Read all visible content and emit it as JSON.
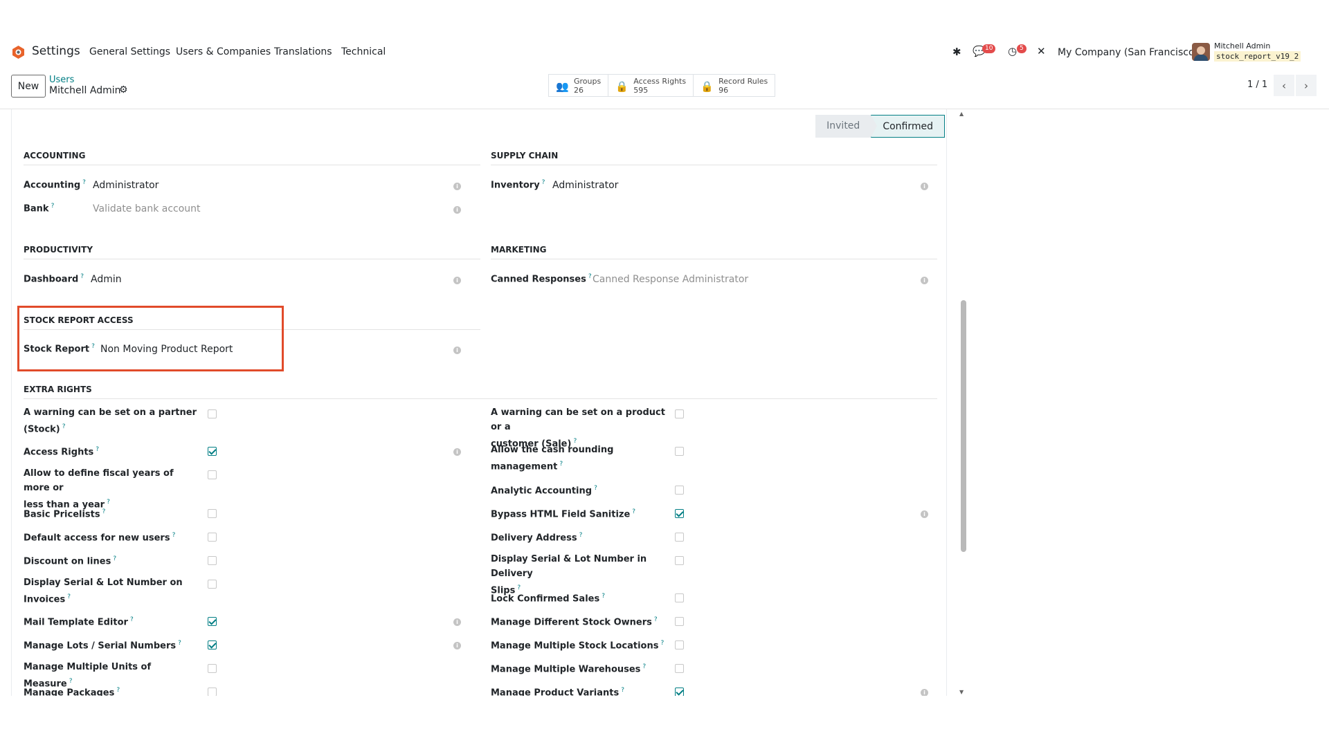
{
  "app": {
    "brand": "Settings",
    "menu": [
      "General Settings",
      "Users & Companies",
      "Translations",
      "Technical"
    ],
    "messages_badge": "10",
    "activities_badge": "5",
    "company": "My Company (San Francisco)",
    "user_name": "Mitchell Admin",
    "database": "stock_report_v19_2",
    "accent": "#017e84",
    "highlight": "#e14b2a"
  },
  "control": {
    "new_label": "New",
    "breadcrumb": "Users",
    "record": "Mitchell Admin",
    "smart": [
      {
        "label": "Groups",
        "count": "26"
      },
      {
        "label": "Access Rights",
        "count": "595"
      },
      {
        "label": "Record Rules",
        "count": "96"
      }
    ],
    "pager": "1 / 1"
  },
  "status": {
    "invited": "Invited",
    "confirmed": "Confirmed"
  },
  "sections": {
    "accounting": {
      "title": "ACCOUNTING",
      "fields": [
        {
          "label": "Accounting",
          "value": "Administrator"
        },
        {
          "label": "Bank",
          "value": "Validate bank account"
        }
      ]
    },
    "supply_chain": {
      "title": "SUPPLY CHAIN",
      "fields": [
        {
          "label": "Inventory",
          "value": "Administrator"
        }
      ]
    },
    "productivity": {
      "title": "PRODUCTIVITY",
      "fields": [
        {
          "label": "Dashboard",
          "value": "Admin"
        }
      ]
    },
    "marketing": {
      "title": "MARKETING",
      "fields": [
        {
          "label": "Canned Responses",
          "value": "Canned Response Administrator"
        }
      ]
    },
    "stock_report": {
      "title": "STOCK REPORT ACCESS",
      "fields": [
        {
          "label": "Stock Report",
          "value": "Non Moving Product Report"
        }
      ]
    },
    "extra_rights": {
      "title": "EXTRA RIGHTS",
      "left": [
        {
          "label1": "A warning can be set on a partner",
          "label2": "(Stock)",
          "checked": false
        },
        {
          "label1": "Access Rights",
          "label2": "",
          "checked": true
        },
        {
          "label1": "Allow to define fiscal years of more or",
          "label2": "less than a year",
          "checked": false
        },
        {
          "label1": "Basic Pricelists",
          "label2": "",
          "checked": false
        },
        {
          "label1": "Default access for new users",
          "label2": "",
          "checked": false
        },
        {
          "label1": "Discount on lines",
          "label2": "",
          "checked": false
        },
        {
          "label1": "Display Serial & Lot Number on",
          "label2": "Invoices",
          "checked": false
        },
        {
          "label1": "Mail Template Editor",
          "label2": "",
          "checked": true
        },
        {
          "label1": "Manage Lots / Serial Numbers",
          "label2": "",
          "checked": true
        },
        {
          "label1": "Manage Multiple Units of Measure",
          "label2": "",
          "checked": false
        },
        {
          "label1": "Manage Packages",
          "label2": "",
          "checked": false
        }
      ],
      "right": [
        {
          "label1": "A warning can be set on a product or a",
          "label2": "customer (Sale)",
          "checked": false
        },
        {
          "label1": "Allow the cash rounding",
          "label2": "management",
          "checked": false
        },
        {
          "label1": "Analytic Accounting",
          "label2": "",
          "checked": false
        },
        {
          "label1": "Bypass HTML Field Sanitize",
          "label2": "",
          "checked": true
        },
        {
          "label1": "Delivery Address",
          "label2": "",
          "checked": false
        },
        {
          "label1": "Display Serial & Lot Number in Delivery",
          "label2": "Slips",
          "checked": false
        },
        {
          "label1": "Lock Confirmed Sales",
          "label2": "",
          "checked": false
        },
        {
          "label1": "Manage Different Stock Owners",
          "label2": "",
          "checked": false
        },
        {
          "label1": "Manage Multiple Stock Locations",
          "label2": "",
          "checked": false
        },
        {
          "label1": "Manage Multiple Warehouses",
          "label2": "",
          "checked": false
        },
        {
          "label1": "Manage Product Variants",
          "label2": "",
          "checked": true
        }
      ]
    }
  }
}
